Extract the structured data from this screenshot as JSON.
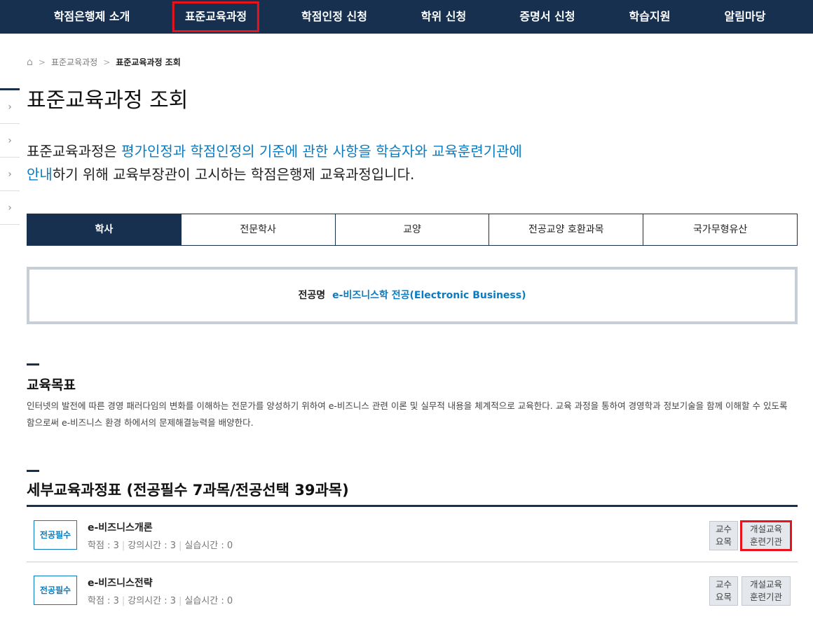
{
  "nav": [
    "학점은행제 소개",
    "표준교육과정",
    "학점인정 신청",
    "학위 신청",
    "증명서 신청",
    "학습지원",
    "알림마당"
  ],
  "breadcrumb": {
    "level1": "표준교육과정",
    "current": "표준교육과정 조회"
  },
  "page_title": "표준교육과정 조회",
  "intro": {
    "p1": "표준교육과정은 ",
    "b1": "평가인정과 학점인정의 기준에 관한 사항을 학습자와 교육훈련기관에",
    "b2": "안내",
    "p2": "하기 위해 교육부장관이 고시하는 학점은행제 교육과정입니다."
  },
  "tabs": [
    "학사",
    "전문학사",
    "교양",
    "전공교양 호환과목",
    "국가무형유산"
  ],
  "major": {
    "label": "전공명",
    "value": "e-비즈니스학 전공(Electronic Business)"
  },
  "goal": {
    "title": "교육목표",
    "text": "인터넷의 발전에 따른 경영 패러다임의 변화를 이해하는 전문가를 양성하기 위하여 e-비즈니스 관련 이론 및 실무적 내용을 체계적으로 교육한다. 교육 과정을 통하여 경영학과 정보기술을 함께 이해할 수 있도록 함으로써 e-비즈니스 환경 하에서의 문제해결능력을 배양한다."
  },
  "curriculum": {
    "title": "세부교육과정표 (전공필수 7과목/전공선택 39과목)",
    "courses": [
      {
        "type": "전공필수",
        "name": "e-비즈니스개론",
        "credit": "학점 : 3",
        "lecture": "강의시간 : 3",
        "practice": "실습시간 : 0",
        "btn1a": "교수",
        "btn1b": "요목",
        "btn2a": "개설교육",
        "btn2b": "훈련기관"
      },
      {
        "type": "전공필수",
        "name": "e-비즈니스전략",
        "credit": "학점 : 3",
        "lecture": "강의시간 : 3",
        "practice": "실습시간 : 0",
        "btn1a": "교수",
        "btn1b": "요목",
        "btn2a": "개설교육",
        "btn2b": "훈련기관"
      }
    ]
  }
}
